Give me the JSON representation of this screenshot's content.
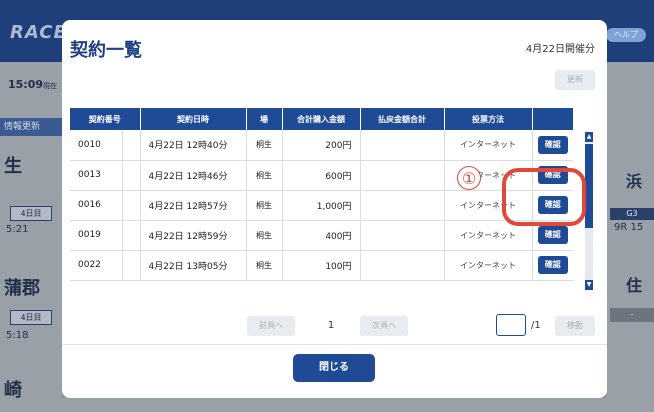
{
  "background": {
    "logo": "RACE",
    "help": "ヘルプ",
    "time": "15:09",
    "time_suffix": "現在",
    "info_tab": "情報更新",
    "venues": [
      {
        "name": "生",
        "badge": "4日目",
        "small": "5:21"
      },
      {
        "name": "蒲郡",
        "badge": "4日目",
        "small": "5:18"
      },
      {
        "name": "崎"
      }
    ],
    "right_venue": "浜",
    "right_badge": "G3",
    "right_small": "9R 15",
    "right_venue2": "住"
  },
  "modal": {
    "title": "契約一覧",
    "date": "4月22日開催分",
    "refresh_label": "更新",
    "columns": [
      "契約番号",
      "契約日時",
      "場",
      "合計購入金額",
      "払戻金額合計",
      "投票方法",
      ""
    ],
    "rows": [
      {
        "id": "0010",
        "datetime": "4月22日 12時40分",
        "venue": "桐生",
        "amount": "200円",
        "payout": "",
        "method": "インターネット",
        "action": "確認"
      },
      {
        "id": "0013",
        "datetime": "4月22日 12時46分",
        "venue": "桐生",
        "amount": "600円",
        "payout": "",
        "method": "インターネット",
        "action": "確認"
      },
      {
        "id": "0016",
        "datetime": "4月22日 12時57分",
        "venue": "桐生",
        "amount": "1,000円",
        "payout": "",
        "method": "インターネット",
        "action": "確認"
      },
      {
        "id": "0019",
        "datetime": "4月22日 12時59分",
        "venue": "桐生",
        "amount": "400円",
        "payout": "",
        "method": "インターネット",
        "action": "確認"
      },
      {
        "id": "0022",
        "datetime": "4月22日 13時05分",
        "venue": "桐生",
        "amount": "100円",
        "payout": "",
        "method": "インターネット",
        "action": "確認"
      }
    ],
    "annotation_number": "①",
    "pager": {
      "prev": "前頁へ",
      "page": "1",
      "next": "次頁へ",
      "total": "/1",
      "move": "移動"
    },
    "close_label": "閉じる"
  },
  "colors": {
    "accent": "#1f4a96",
    "annotation": "#e2483a",
    "title": "#1c3f86"
  }
}
